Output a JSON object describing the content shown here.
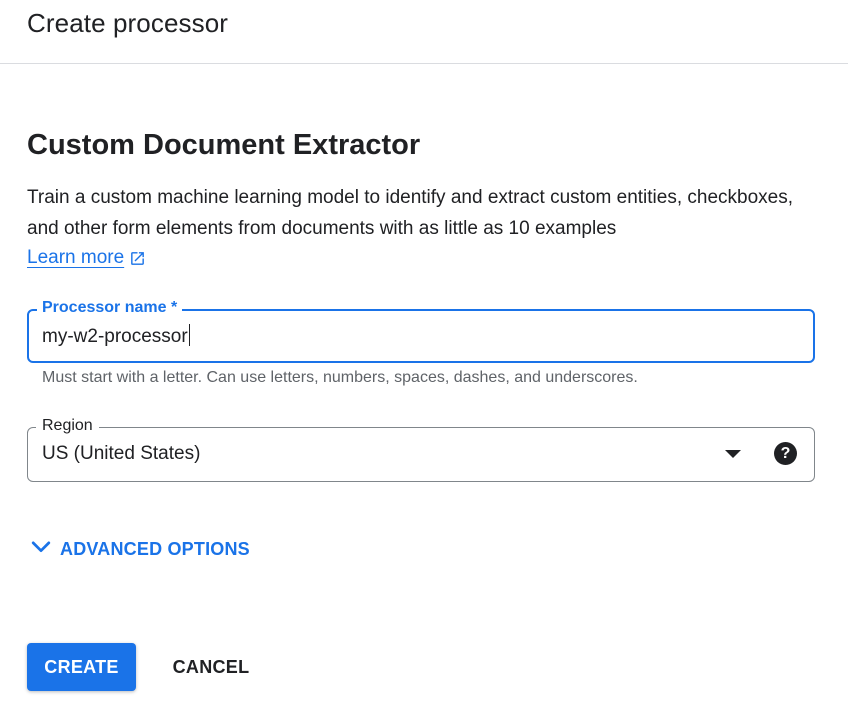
{
  "header": {
    "title": "Create processor"
  },
  "processor": {
    "type_title": "Custom Document Extractor",
    "description": "Train a custom machine learning model to identify and extract custom entities, checkboxes, and other form elements from documents with as little as 10 examples",
    "learn_more": "Learn more",
    "learn_more_icon": "external-link-icon"
  },
  "form": {
    "name_field": {
      "label": "Processor name *",
      "value": "my-w2-processor",
      "hint": "Must start with a letter. Can use letters, numbers, spaces, dashes, and underscores."
    },
    "region_field": {
      "label": "Region",
      "value": "US (United States)",
      "dropdown_icon": "caret-down-icon",
      "help_icon": "help-icon"
    },
    "advanced_options": {
      "label": "ADVANCED OPTIONS",
      "icon": "chevron-down-icon"
    }
  },
  "actions": {
    "create_label": "CREATE",
    "cancel_label": "CANCEL"
  },
  "colors": {
    "accent": "#1a73e8",
    "text": "#202124",
    "secondary_text": "#5f6368",
    "divider": "#dadce0",
    "outline": "#80868b"
  }
}
